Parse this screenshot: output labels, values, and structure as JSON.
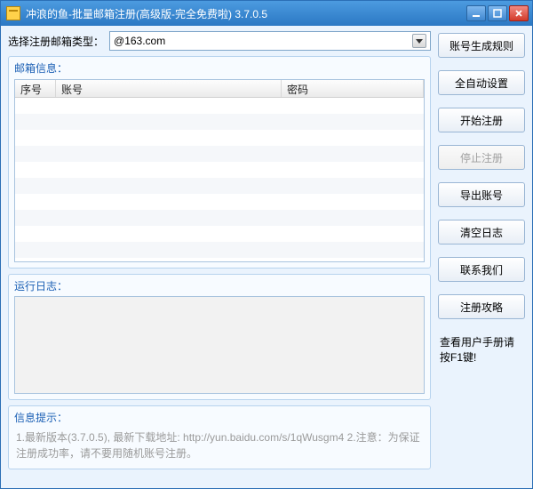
{
  "window": {
    "title": "冲浪的鱼-批量邮箱注册(高级版-完全免费啦) 3.7.0.5"
  },
  "select_row": {
    "label": "选择注册邮箱类型：",
    "value": "@163.com"
  },
  "mail_group": {
    "title": "邮箱信息：",
    "columns": {
      "seq": "序号",
      "acct": "账号",
      "pwd": "密码"
    }
  },
  "log_group": {
    "title": "运行日志："
  },
  "info_group": {
    "title": "信息提示：",
    "text": "1.最新版本(3.7.0.5), 最新下载地址: http://yun.baidu.com/s/1qWusgm4 2.注意：为保证注册成功率，请不要用随机账号注册。"
  },
  "buttons": {
    "gen_rule": "账号生成规则",
    "auto_set": "全自动设置",
    "start": "开始注册",
    "stop": "停止注册",
    "export": "导出账号",
    "clear_log": "清空日志",
    "contact": "联系我们",
    "guide": "注册攻略"
  },
  "help_text": "查看用户手册请按F1键!"
}
